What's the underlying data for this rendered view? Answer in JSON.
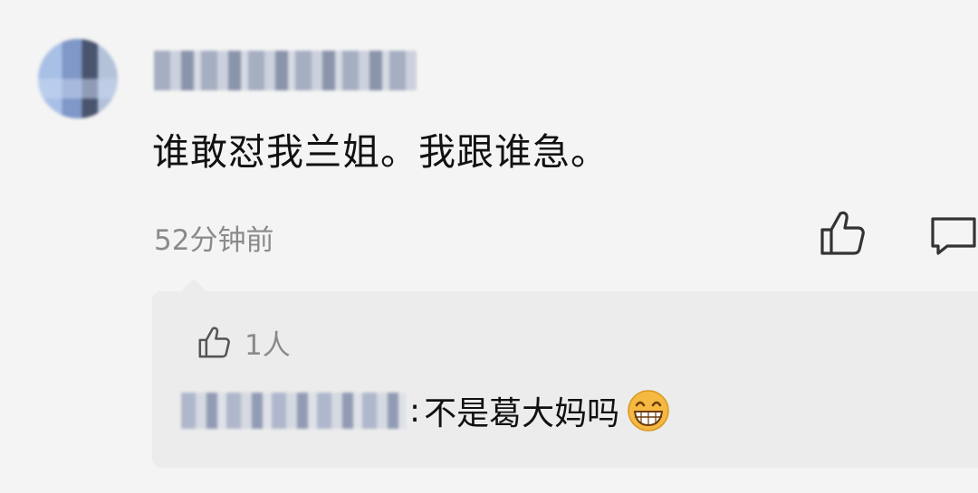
{
  "comment": {
    "text": "谁敢怼我兰姐。我跟谁急。",
    "time": "52分钟前"
  },
  "reply": {
    "like_count": "1人",
    "separator": ":",
    "text": "不是葛大妈吗"
  },
  "icons": {
    "like": "thumbs-up-icon",
    "reply": "comment-bubble-icon",
    "emoji": "grinning-face-emoji"
  },
  "colors": {
    "background": "#f4f4f4",
    "reply_box": "#ececec",
    "text_primary": "#111111",
    "text_secondary": "#8a8a8a",
    "emoji_yellow": "#f5b942"
  }
}
